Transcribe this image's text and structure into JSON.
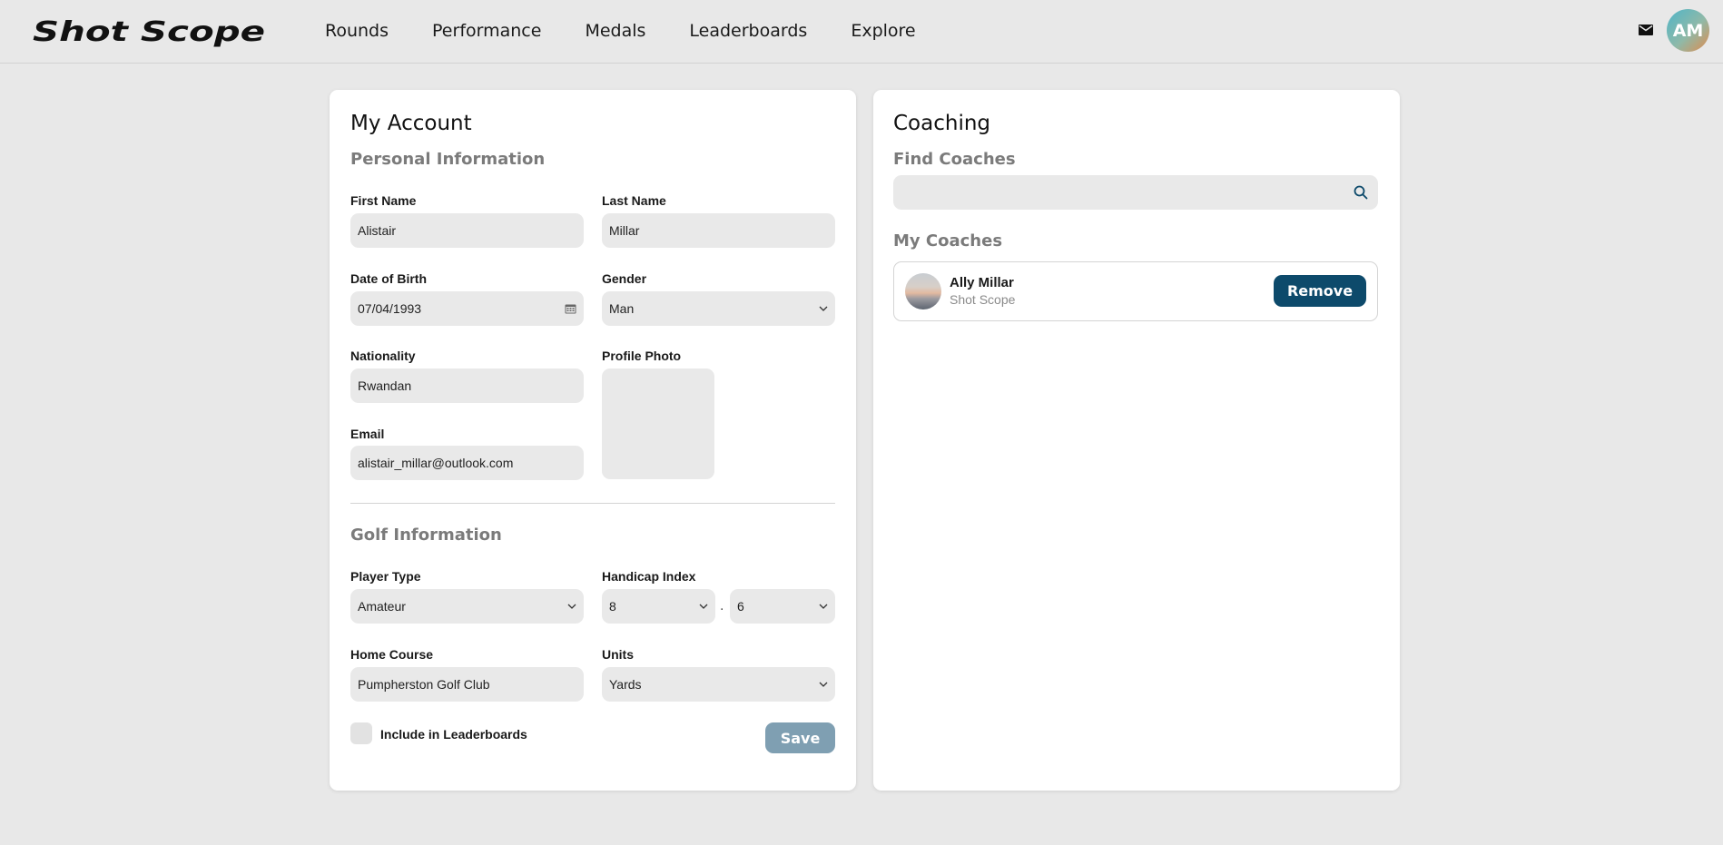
{
  "brand": {
    "logo_text": "Shot Scope"
  },
  "nav": {
    "items": [
      {
        "label": "Rounds"
      },
      {
        "label": "Performance"
      },
      {
        "label": "Medals"
      },
      {
        "label": "Leaderboards"
      },
      {
        "label": "Explore"
      }
    ],
    "mail_icon": "mail-icon",
    "avatar_initials": "AM"
  },
  "account": {
    "title": "My Account",
    "personal_heading": "Personal Information",
    "first_name": {
      "label": "First Name",
      "value": "Alistair"
    },
    "last_name": {
      "label": "Last Name",
      "value": "Millar"
    },
    "dob": {
      "label": "Date of Birth",
      "value": "07/04/1993",
      "icon": "calendar-icon"
    },
    "gender": {
      "label": "Gender",
      "value": "Man"
    },
    "nationality": {
      "label": "Nationality",
      "value": "Rwandan"
    },
    "profile_photo": {
      "label": "Profile Photo"
    },
    "email": {
      "label": "Email",
      "value": "alistair_millar@outlook.com"
    },
    "golf_heading": "Golf Information",
    "player_type": {
      "label": "Player Type",
      "value": "Amateur"
    },
    "handicap": {
      "label": "Handicap Index",
      "whole": "8",
      "separator": ".",
      "decimal": "6"
    },
    "home_course": {
      "label": "Home Course",
      "value": "Pumpherston Golf Club"
    },
    "units": {
      "label": "Units",
      "value": "Yards"
    },
    "leaderboards_checkbox": {
      "label": "Include in Leaderboards",
      "checked": false
    },
    "save_label": "Save"
  },
  "coaching": {
    "title": "Coaching",
    "find_heading": "Find Coaches",
    "search": {
      "value": "",
      "icon": "search-icon"
    },
    "my_coaches_heading": "My Coaches",
    "coaches": [
      {
        "name": "Ally Millar",
        "club": "Shot Scope",
        "remove_label": "Remove"
      }
    ]
  },
  "colors": {
    "background": "#e8e8e8",
    "card": "#ffffff",
    "field": "#e9e9e9",
    "primary_button": "#0d4a6b",
    "disabled_button": "#7f9fb2",
    "section_heading": "#7b7b7b"
  }
}
